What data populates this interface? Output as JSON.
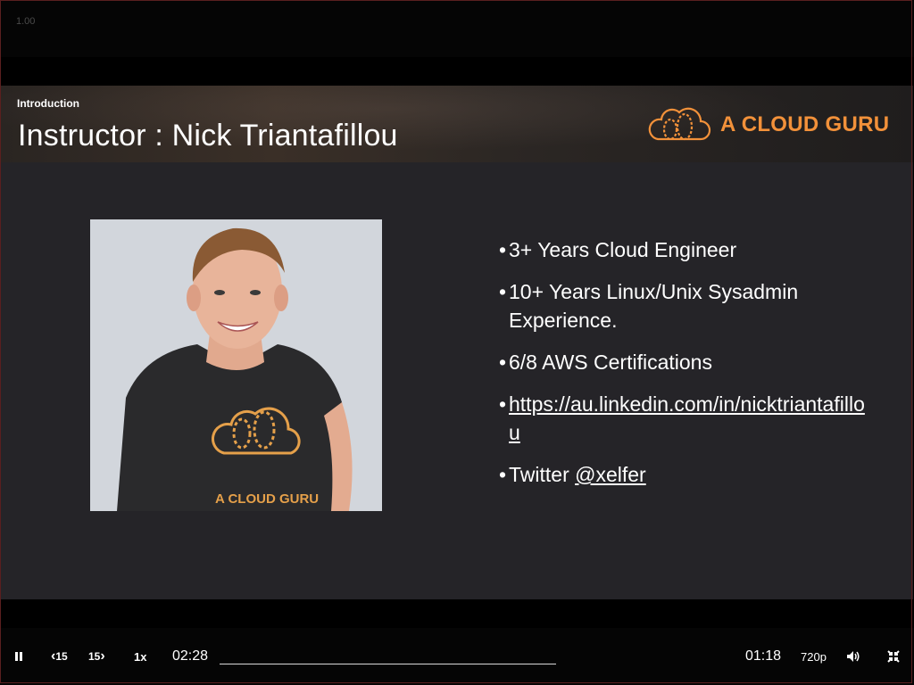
{
  "overlay": {
    "speed_readout": "1.00"
  },
  "slide": {
    "section": "Introduction",
    "title": "Instructor : Nick Triantafillou",
    "brand": "A CLOUD GURU",
    "shirt_logo_text": "A CLOUD GURU",
    "bullets": [
      {
        "text": "3+ Years Cloud Engineer"
      },
      {
        "text": "10+ Years Linux/Unix Sysadmin Experience."
      },
      {
        "text": "6/8 AWS Certifications"
      },
      {
        "link": "https://au.linkedin.com/in/nicktriantafillou"
      },
      {
        "prefix": "Twitter ",
        "link": "@xelfer"
      }
    ]
  },
  "player": {
    "play_pause_icon": "pause-icon",
    "rewind_label": "15",
    "forward_label": "15",
    "speed_label": "1x",
    "elapsed": "02:28",
    "remaining": "01:18",
    "quality": "720p",
    "volume_icon": "volume-icon",
    "fullscreen_icon": "exit-fullscreen-icon",
    "brand_color": "#f2913a"
  }
}
